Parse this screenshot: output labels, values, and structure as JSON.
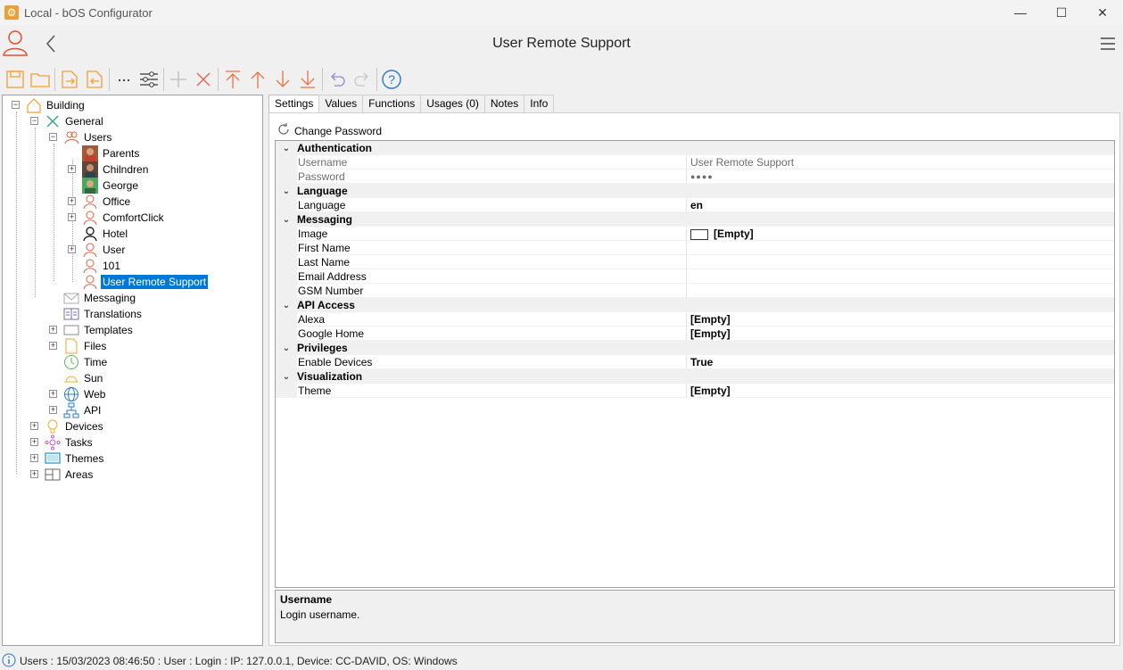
{
  "window": {
    "title": "Local - bOS Configurator",
    "controls": [
      "—",
      "☐",
      "✕"
    ]
  },
  "header": {
    "title": "User Remote Support"
  },
  "tree": {
    "nodes": [
      {
        "label": "Building",
        "icon": "building-icon"
      },
      {
        "label": "General",
        "icon": "tools-icon"
      },
      {
        "label": "Users",
        "icon": "users-icon"
      },
      {
        "label": "Parents",
        "icon": "photo-avatar"
      },
      {
        "label": "Chilndren",
        "icon": "photo-avatar"
      },
      {
        "label": "George",
        "icon": "photo-avatar"
      },
      {
        "label": "Office",
        "icon": "user-outline-icon"
      },
      {
        "label": "ComfortClick",
        "icon": "user-outline-icon"
      },
      {
        "label": "Hotel",
        "icon": "user-black-icon"
      },
      {
        "label": "User",
        "icon": "user-outline-icon"
      },
      {
        "label": "101",
        "icon": "user-outline-icon"
      },
      {
        "label": "User Remote Support",
        "icon": "user-outline-icon"
      },
      {
        "label": "Messaging",
        "icon": "envelope-icon"
      },
      {
        "label": "Translations",
        "icon": "translations-icon"
      },
      {
        "label": "Templates",
        "icon": "template-icon"
      },
      {
        "label": "Files",
        "icon": "file-icon"
      },
      {
        "label": "Time",
        "icon": "clock-icon"
      },
      {
        "label": "Sun",
        "icon": "sun-icon"
      },
      {
        "label": "Web",
        "icon": "globe-icon"
      },
      {
        "label": "API",
        "icon": "network-icon"
      },
      {
        "label": "Devices",
        "icon": "bulb-icon"
      },
      {
        "label": "Tasks",
        "icon": "tasks-icon"
      },
      {
        "label": "Themes",
        "icon": "monitor-icon"
      },
      {
        "label": "Areas",
        "icon": "areas-icon"
      }
    ]
  },
  "tabs": [
    "Settings",
    "Values",
    "Functions",
    "Usages (0)",
    "Notes",
    "Info"
  ],
  "actions": {
    "change_password": "Change Password"
  },
  "grid": {
    "categories": {
      "authentication": "Authentication",
      "language": "Language",
      "messaging": "Messaging",
      "api_access": "API Access",
      "privileges": "Privileges",
      "visualization": "Visualization"
    },
    "props": {
      "username": {
        "label": "Username",
        "value": "User Remote Support"
      },
      "password": {
        "label": "Password",
        "value": "●●●●"
      },
      "language": {
        "label": "Language",
        "value": "en"
      },
      "image": {
        "label": "Image",
        "value": "[Empty]"
      },
      "first_name": {
        "label": "First Name",
        "value": ""
      },
      "last_name": {
        "label": "Last Name",
        "value": ""
      },
      "email": {
        "label": "Email Address",
        "value": ""
      },
      "gsm": {
        "label": "GSM Number",
        "value": ""
      },
      "alexa": {
        "label": "Alexa",
        "value": "[Empty]"
      },
      "google_home": {
        "label": "Google Home",
        "value": "[Empty]"
      },
      "enable_devices": {
        "label": "Enable Devices",
        "value": "True"
      },
      "theme": {
        "label": "Theme",
        "value": "[Empty]"
      }
    }
  },
  "help": {
    "title": "Username",
    "description": "Login username."
  },
  "status": {
    "text": "Users : 15/03/2023 08:46:50 : User : Login : IP: 127.0.0.1, Device: CC-DAVID, OS: Windows"
  },
  "colors": {
    "accent": "#0078d7",
    "toolbar_orange": "#f0a030",
    "app_icon": "#e8a03a"
  }
}
